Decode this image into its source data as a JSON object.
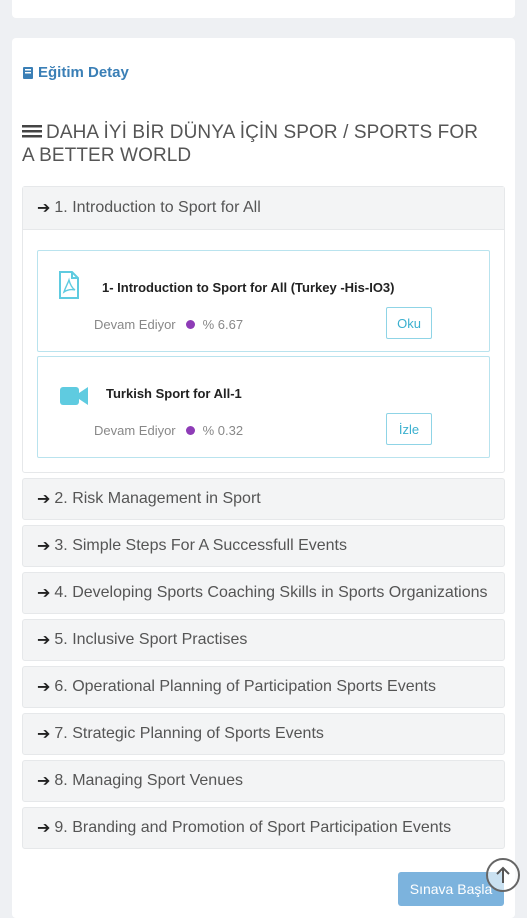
{
  "section": {
    "link_label": "Eğitim Detay",
    "icon": "book-icon"
  },
  "course": {
    "title": "DAHA İYİ BİR DÜNYA İÇİN SPOR / SPORTS FOR A BETTER WORLD",
    "icon": "list-icon"
  },
  "modules": [
    {
      "label": "1. Introduction to Sport for All",
      "expanded": true
    },
    {
      "label": "2. Risk Management in Sport"
    },
    {
      "label": "3. Simple Steps For A Successfull Events"
    },
    {
      "label": "4. Developing Sports Coaching Skills in Sports Organizations"
    },
    {
      "label": "5. Inclusive Sport Practises"
    },
    {
      "label": "6. Operational Planning of Participation Sports Events"
    },
    {
      "label": "7. Strategic Planning of Sports Events"
    },
    {
      "label": "8. Managing Sport Venues"
    },
    {
      "label": "9. Branding and Promotion of Sport Participation Events"
    }
  ],
  "materials": [
    {
      "title": "1- Introduction to Sport for All (Turkey -His-IO3)",
      "status": "Devam Ediyor",
      "progress": "% 6.67",
      "button": "Oku",
      "icon": "pdf-icon"
    },
    {
      "title": "Turkish Sport for All-1",
      "status": "Devam Ediyor",
      "progress": "% 0.32",
      "button": "İzle",
      "icon": "video-icon"
    }
  ],
  "actions": {
    "start_exam": "Sınava Başla"
  },
  "colors": {
    "accent": "#3a7fb6",
    "cyan": "#5fcbe0",
    "status_dot": "#8e3cb7",
    "button_bg": "#7cb3dd"
  }
}
